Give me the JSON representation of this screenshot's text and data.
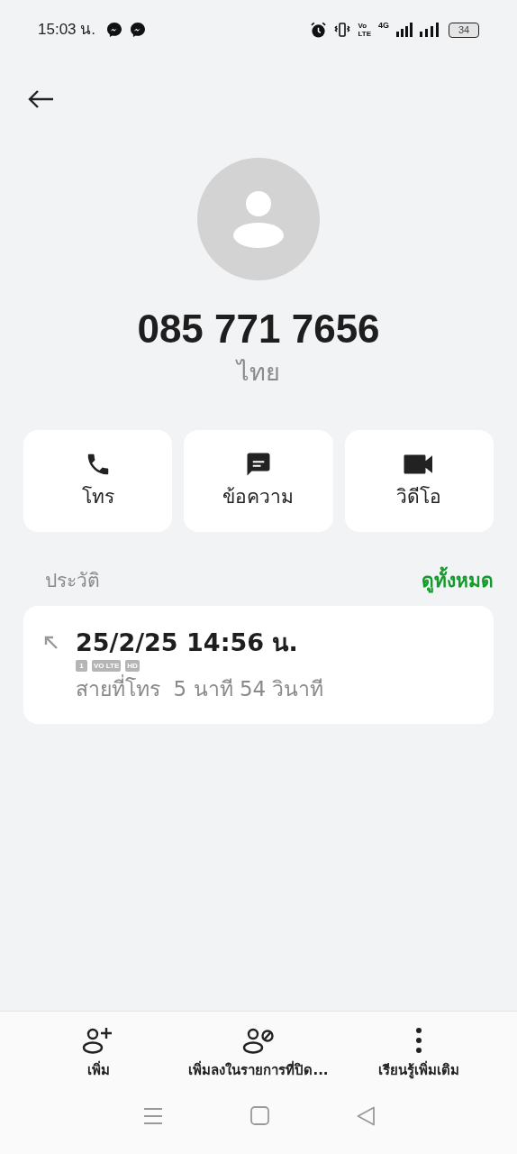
{
  "status_bar": {
    "time": "15:03 น.",
    "notifications": [
      {
        "kind": "messenger"
      },
      {
        "kind": "messenger"
      }
    ],
    "network": "4G",
    "volte": [
      "Vo",
      "LTE"
    ],
    "battery": "34"
  },
  "contact": {
    "number": "085 771 7656",
    "region": "ไทย"
  },
  "actions": [
    {
      "kind": "call",
      "label": "โทร"
    },
    {
      "kind": "message",
      "label": "ข้อความ"
    },
    {
      "kind": "video",
      "label": "วิดีโอ"
    }
  ],
  "history": {
    "title": "ประวัติ",
    "link": "ดูทั้งหมด",
    "entries": [
      {
        "kind": "outgoing",
        "datetime": "25/2/25 14:56 น.",
        "badges": [
          "1",
          "VO LTE",
          "HD"
        ],
        "detail": "สายที่โทร  5 นาที 54 วินาที"
      }
    ]
  },
  "bottom_actions": [
    {
      "kind": "add",
      "label": "เพิ่ม"
    },
    {
      "kind": "block",
      "label": "เพิ่มลงในรายการที่ปิด..."
    },
    {
      "kind": "more",
      "label": "เรียนรู้เพิ่มเติม"
    }
  ]
}
